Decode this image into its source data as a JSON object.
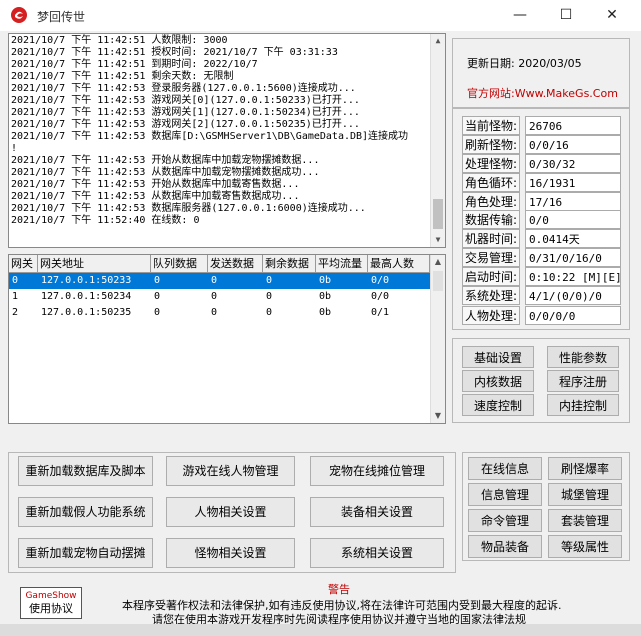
{
  "window": {
    "title": "梦回传世",
    "min": "—",
    "max": "☐",
    "close": "✕"
  },
  "log": [
    "2021/10/7 下午 11:42:51 人数限制: 3000",
    "2021/10/7 下午 11:42:51 授权时间: 2021/10/7 下午 03:31:33",
    "2021/10/7 下午 11:42:51 到期时间: 2022/10/7",
    "2021/10/7 下午 11:42:51 剩余天数: 无限制",
    "2021/10/7 下午 11:42:53 登录服务器(127.0.0.1:5600)连接成功...",
    "2021/10/7 下午 11:42:53 游戏网关[0](127.0.0.1:50233)已打开...",
    "2021/10/7 下午 11:42:53 游戏网关[1](127.0.0.1:50234)已打开...",
    "2021/10/7 下午 11:42:53 游戏网关[2](127.0.0.1:50235)已打开...",
    "2021/10/7 下午 11:42:53 数据库[D:\\GSMHServer1\\DB\\GameData.DB]连接成功",
    "!",
    "2021/10/7 下午 11:42:53 开始从数据库中加载宠物摆摊数据...",
    "2021/10/7 下午 11:42:53 从数据库中加载宠物摆摊数据成功...",
    "2021/10/7 下午 11:42:53 开始从数据库中加载寄售数据...",
    "2021/10/7 下午 11:42:53 从数据库中加载寄售数据成功...",
    "2021/10/7 下午 11:42:53 数据库服务器(127.0.0.1:6000)连接成功...",
    "2021/10/7 下午 11:52:40 在线数: 0"
  ],
  "gateway_table": {
    "headers": [
      "网关",
      "网关地址",
      "队列数据",
      "发送数据",
      "剩余数据",
      "平均流量",
      "最高人数"
    ],
    "rows": [
      [
        "0",
        "127.0.0.1:50233",
        "0",
        "0",
        "0",
        "0b",
        "0/0"
      ],
      [
        "1",
        "127.0.0.1:50234",
        "0",
        "0",
        "0",
        "0b",
        "0/0"
      ],
      [
        "2",
        "127.0.0.1:50235",
        "0",
        "0",
        "0",
        "0b",
        "0/1"
      ]
    ]
  },
  "info": {
    "update_date": "更新日期: 2020/03/05",
    "website": "官方网站:Www.MakeGs.Com"
  },
  "stats": [
    {
      "label": "当前怪物:",
      "value": "26706"
    },
    {
      "label": "刷新怪物:",
      "value": "0/0/16"
    },
    {
      "label": "处理怪物:",
      "value": "0/30/32"
    },
    {
      "label": "角色循环:",
      "value": "16/1931"
    },
    {
      "label": "角色处理:",
      "value": "17/16"
    },
    {
      "label": "数据传输:",
      "value": "0/0"
    },
    {
      "label": "机器时间:",
      "value": "0.0414天"
    },
    {
      "label": "交易管理:",
      "value": "0/31/0/16/0"
    },
    {
      "label": "启动时间:",
      "value": "0:10:22 [M][E]"
    },
    {
      "label": "系统处理:",
      "value": "4/1/(0/0)/0"
    },
    {
      "label": "人物处理:",
      "value": "0/0/0/0"
    }
  ],
  "side_buttons": [
    "基础设置",
    "性能参数",
    "内核数据",
    "程序注册",
    "速度控制",
    "内挂控制"
  ],
  "bottom_buttons": [
    "重新加载数据库及脚本",
    "游戏在线人物管理",
    "宠物在线摊位管理",
    "重新加载假人功能系统",
    "人物相关设置",
    "装备相关设置",
    "重新加载宠物自动摆摊",
    "怪物相关设置",
    "系统相关设置"
  ],
  "right_buttons": [
    "在线信息",
    "刷怪爆率",
    "信息管理",
    "城堡管理",
    "命令管理",
    "套装管理",
    "物品装备",
    "等级属性"
  ],
  "footer": {
    "gameshow_top": "GameShow",
    "gameshow_bottom": "使用协议",
    "warning_title": "警告",
    "warning_line1": "本程序受著作权法和法律保护,如有违反使用协议,将在法律许可范围内受到最大程度的起诉.",
    "warning_line2": "请您在使用本游戏开发程序时先阅读程序使用协议并遵守当地的国家法律法规"
  }
}
